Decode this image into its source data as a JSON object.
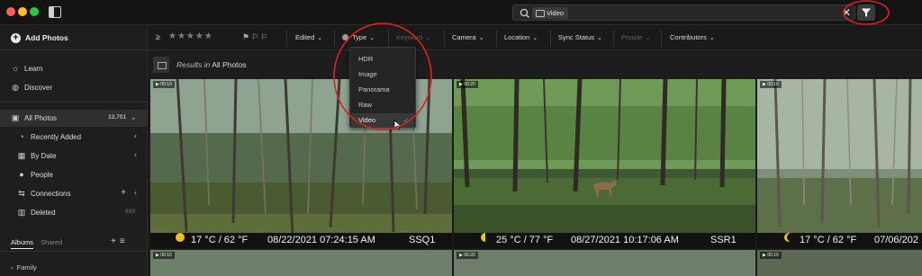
{
  "search": {
    "chip_label": "Video"
  },
  "sidebar": {
    "add_photos": "Add Photos",
    "learn": "Learn",
    "discover": "Discover",
    "all_photos": "All Photos",
    "all_photos_count": "13,701",
    "recently_added": "Recently Added",
    "by_date": "By Date",
    "people": "People",
    "connections": "Connections",
    "deleted": "Deleted",
    "deleted_count": "699",
    "tab_albums": "Albums",
    "tab_shared": "Shared",
    "family": "Family"
  },
  "filters": {
    "ge": "≥",
    "edited": "Edited",
    "type": "Type",
    "keyword": "Keyword",
    "camera": "Camera",
    "location": "Location",
    "sync_status": "Sync Status",
    "people": "People",
    "contributors": "Contributors"
  },
  "results": {
    "prefix": "Results in",
    "scope": "All Photos"
  },
  "type_menu": {
    "options": [
      "HDR",
      "Image",
      "Panorama",
      "Raw",
      "Video"
    ],
    "selected": "Video"
  },
  "photos": [
    {
      "duration": "00:10",
      "temp": "17 °C / 62 °F",
      "datetime": "08/22/2021 07:24:15 AM",
      "camera": "SSQ1"
    },
    {
      "duration": "00:20",
      "temp": "25 °C / 77 °F",
      "datetime": "08/27/2021 10:17:06 AM",
      "camera": "SSR1"
    },
    {
      "duration": "00:10",
      "temp": "17 °C / 62 °F",
      "datetime": "07/06/202"
    }
  ],
  "colors": {
    "annotation": "#e01f1f",
    "check": "#3b8fe8",
    "sun": "#f2c21b"
  }
}
